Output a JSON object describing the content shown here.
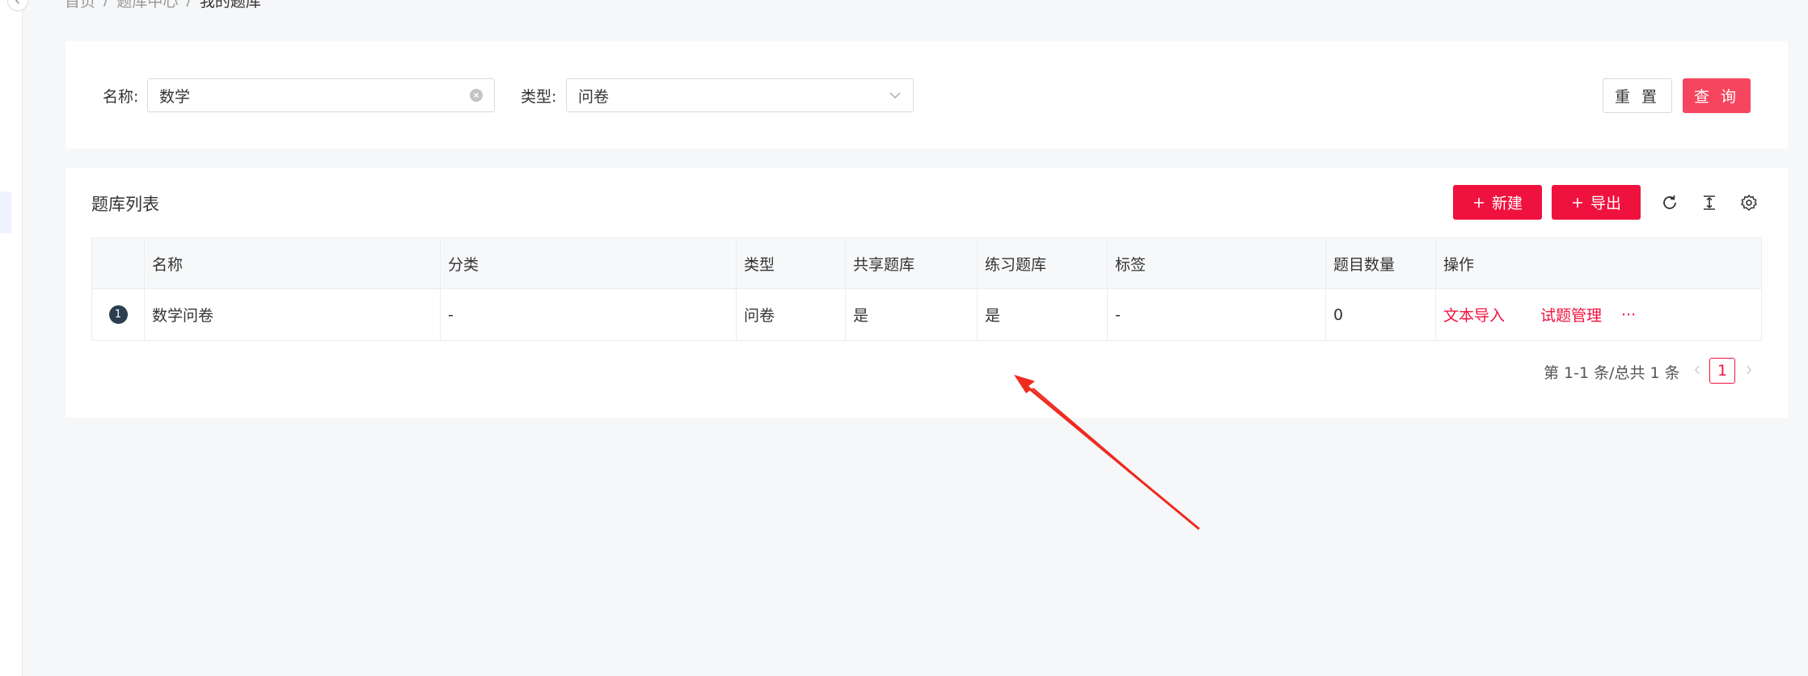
{
  "breadcrumb": {
    "items": [
      "首页",
      "题库中心",
      "我的题库"
    ],
    "separator": "/"
  },
  "search": {
    "name_label": "名称:",
    "name_value": "数学",
    "type_label": "类型:",
    "type_value": "问卷",
    "reset_label": "重 置",
    "query_label": "查 询"
  },
  "list": {
    "title": "题库列表",
    "new_label": "新建",
    "export_label": "导出",
    "columns": [
      "名称",
      "分类",
      "类型",
      "共享题库",
      "练习题库",
      "标签",
      "题目数量",
      "操作"
    ],
    "rows": [
      {
        "index": "1",
        "name": "数学问卷",
        "category": "-",
        "type": "问卷",
        "shared": "是",
        "practice": "是",
        "tags": "-",
        "count": "0",
        "actions": [
          "文本导入",
          "试题管理",
          "···"
        ]
      }
    ]
  },
  "pagination": {
    "total_text": "第 1-1 条/总共 1 条",
    "current_page": "1"
  },
  "colors": {
    "accent": "#f0123e",
    "query_button": "#f5455f",
    "background": "#f6f7f9",
    "annotation_arrow": "#ee2a1f"
  },
  "icons": {
    "collapse": "chevron-left-icon",
    "clear": "clear-icon",
    "dropdown": "chevron-down-icon",
    "plus": "plus-icon",
    "refresh": "refresh-icon",
    "density": "column-height-icon",
    "settings": "gear-icon"
  }
}
